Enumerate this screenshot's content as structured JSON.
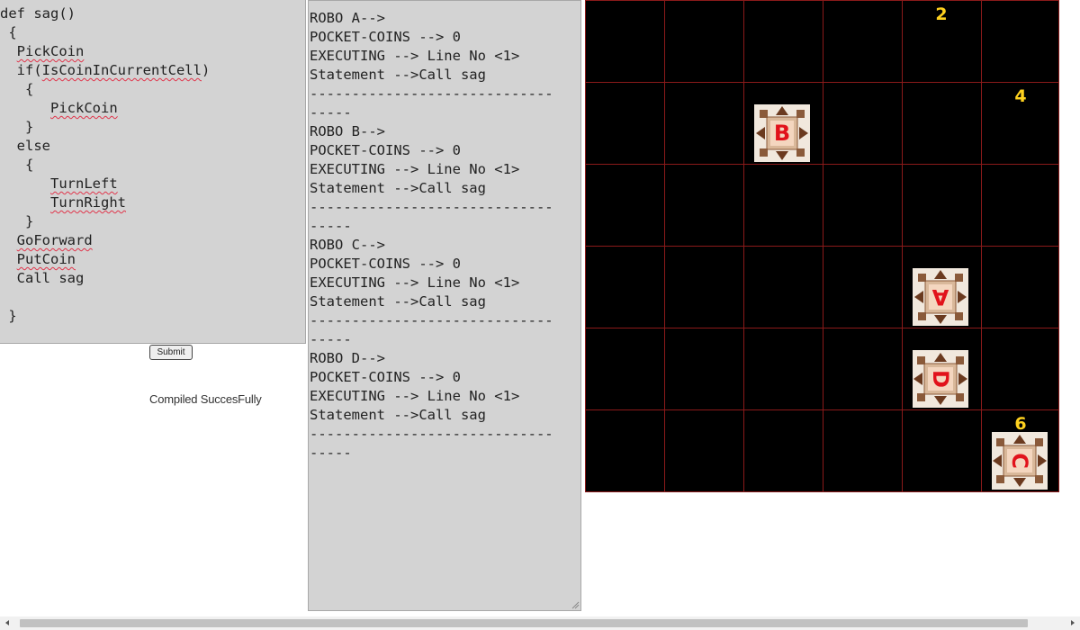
{
  "editor": {
    "lines": [
      {
        "indent": "",
        "parts": [
          {
            "t": "def sag()"
          }
        ]
      },
      {
        "indent": " ",
        "parts": [
          {
            "t": "{"
          }
        ]
      },
      {
        "indent": "  ",
        "parts": [
          {
            "t": "PickCoin",
            "sq": true
          }
        ]
      },
      {
        "indent": "  ",
        "parts": [
          {
            "t": "if("
          },
          {
            "t": "IsCoinInCurrentCell",
            "sq": true
          },
          {
            "t": ")"
          }
        ]
      },
      {
        "indent": "   ",
        "parts": [
          {
            "t": "{"
          }
        ]
      },
      {
        "indent": "      ",
        "parts": [
          {
            "t": "PickCoin",
            "sq": true
          }
        ]
      },
      {
        "indent": "   ",
        "parts": [
          {
            "t": "}"
          }
        ]
      },
      {
        "indent": "  ",
        "parts": [
          {
            "t": "else"
          }
        ]
      },
      {
        "indent": "   ",
        "parts": [
          {
            "t": "{"
          }
        ]
      },
      {
        "indent": "      ",
        "parts": [
          {
            "t": "TurnLeft",
            "sq": true
          }
        ]
      },
      {
        "indent": "      ",
        "parts": [
          {
            "t": "TurnRight",
            "sq": true
          }
        ]
      },
      {
        "indent": "   ",
        "parts": [
          {
            "t": "}"
          }
        ]
      },
      {
        "indent": "  ",
        "parts": [
          {
            "t": "GoForward",
            "sq": true
          }
        ]
      },
      {
        "indent": "  ",
        "parts": [
          {
            "t": "PutCoin",
            "sq": true
          }
        ]
      },
      {
        "indent": "  ",
        "parts": [
          {
            "t": "Call sag"
          }
        ]
      },
      {
        "indent": "",
        "parts": [
          {
            "t": ""
          }
        ]
      },
      {
        "indent": " ",
        "parts": [
          {
            "t": "}"
          }
        ]
      }
    ]
  },
  "controls": {
    "submit_label": "Submit",
    "status_message": "Compiled SuccesFully"
  },
  "robot_state": {
    "lines": [
      "ROBO A-->",
      "POCKET-COINS --> 0",
      "EXECUTING --> Line No <1>",
      "Statement -->Call sag",
      "-----------------------------",
      "-----",
      "ROBO B-->",
      "POCKET-COINS --> 0",
      "EXECUTING --> Line No <1>",
      "Statement -->Call sag",
      "-----------------------------",
      "-----",
      "ROBO C-->",
      "POCKET-COINS --> 0",
      "EXECUTING --> Line No <1>",
      "Statement -->Call sag",
      "-----------------------------",
      "-----",
      "ROBO D-->",
      "POCKET-COINS --> 0",
      "EXECUTING --> Line No <1>",
      "Statement -->Call sag",
      "-----------------------------",
      "-----"
    ]
  },
  "board": {
    "columns": 6,
    "rows": 6,
    "background_color": "#000000",
    "grid_color": "#8b1a1a",
    "coin_color": "#ffd21f",
    "coins": [
      {
        "row": 0,
        "col": 4,
        "count": "2"
      },
      {
        "row": 1,
        "col": 5,
        "count": "4"
      },
      {
        "row": 5,
        "col": 5,
        "count": "6"
      }
    ],
    "robots": [
      {
        "name": "B",
        "row": 1,
        "col": 2,
        "facing": "up"
      },
      {
        "name": "A",
        "row": 3,
        "col": 4,
        "facing": "down"
      },
      {
        "name": "D",
        "row": 4,
        "col": 4,
        "facing": "right"
      },
      {
        "name": "C",
        "row": 5,
        "col": 5,
        "facing": "right"
      }
    ],
    "robot_label_color": "#e1121b"
  }
}
